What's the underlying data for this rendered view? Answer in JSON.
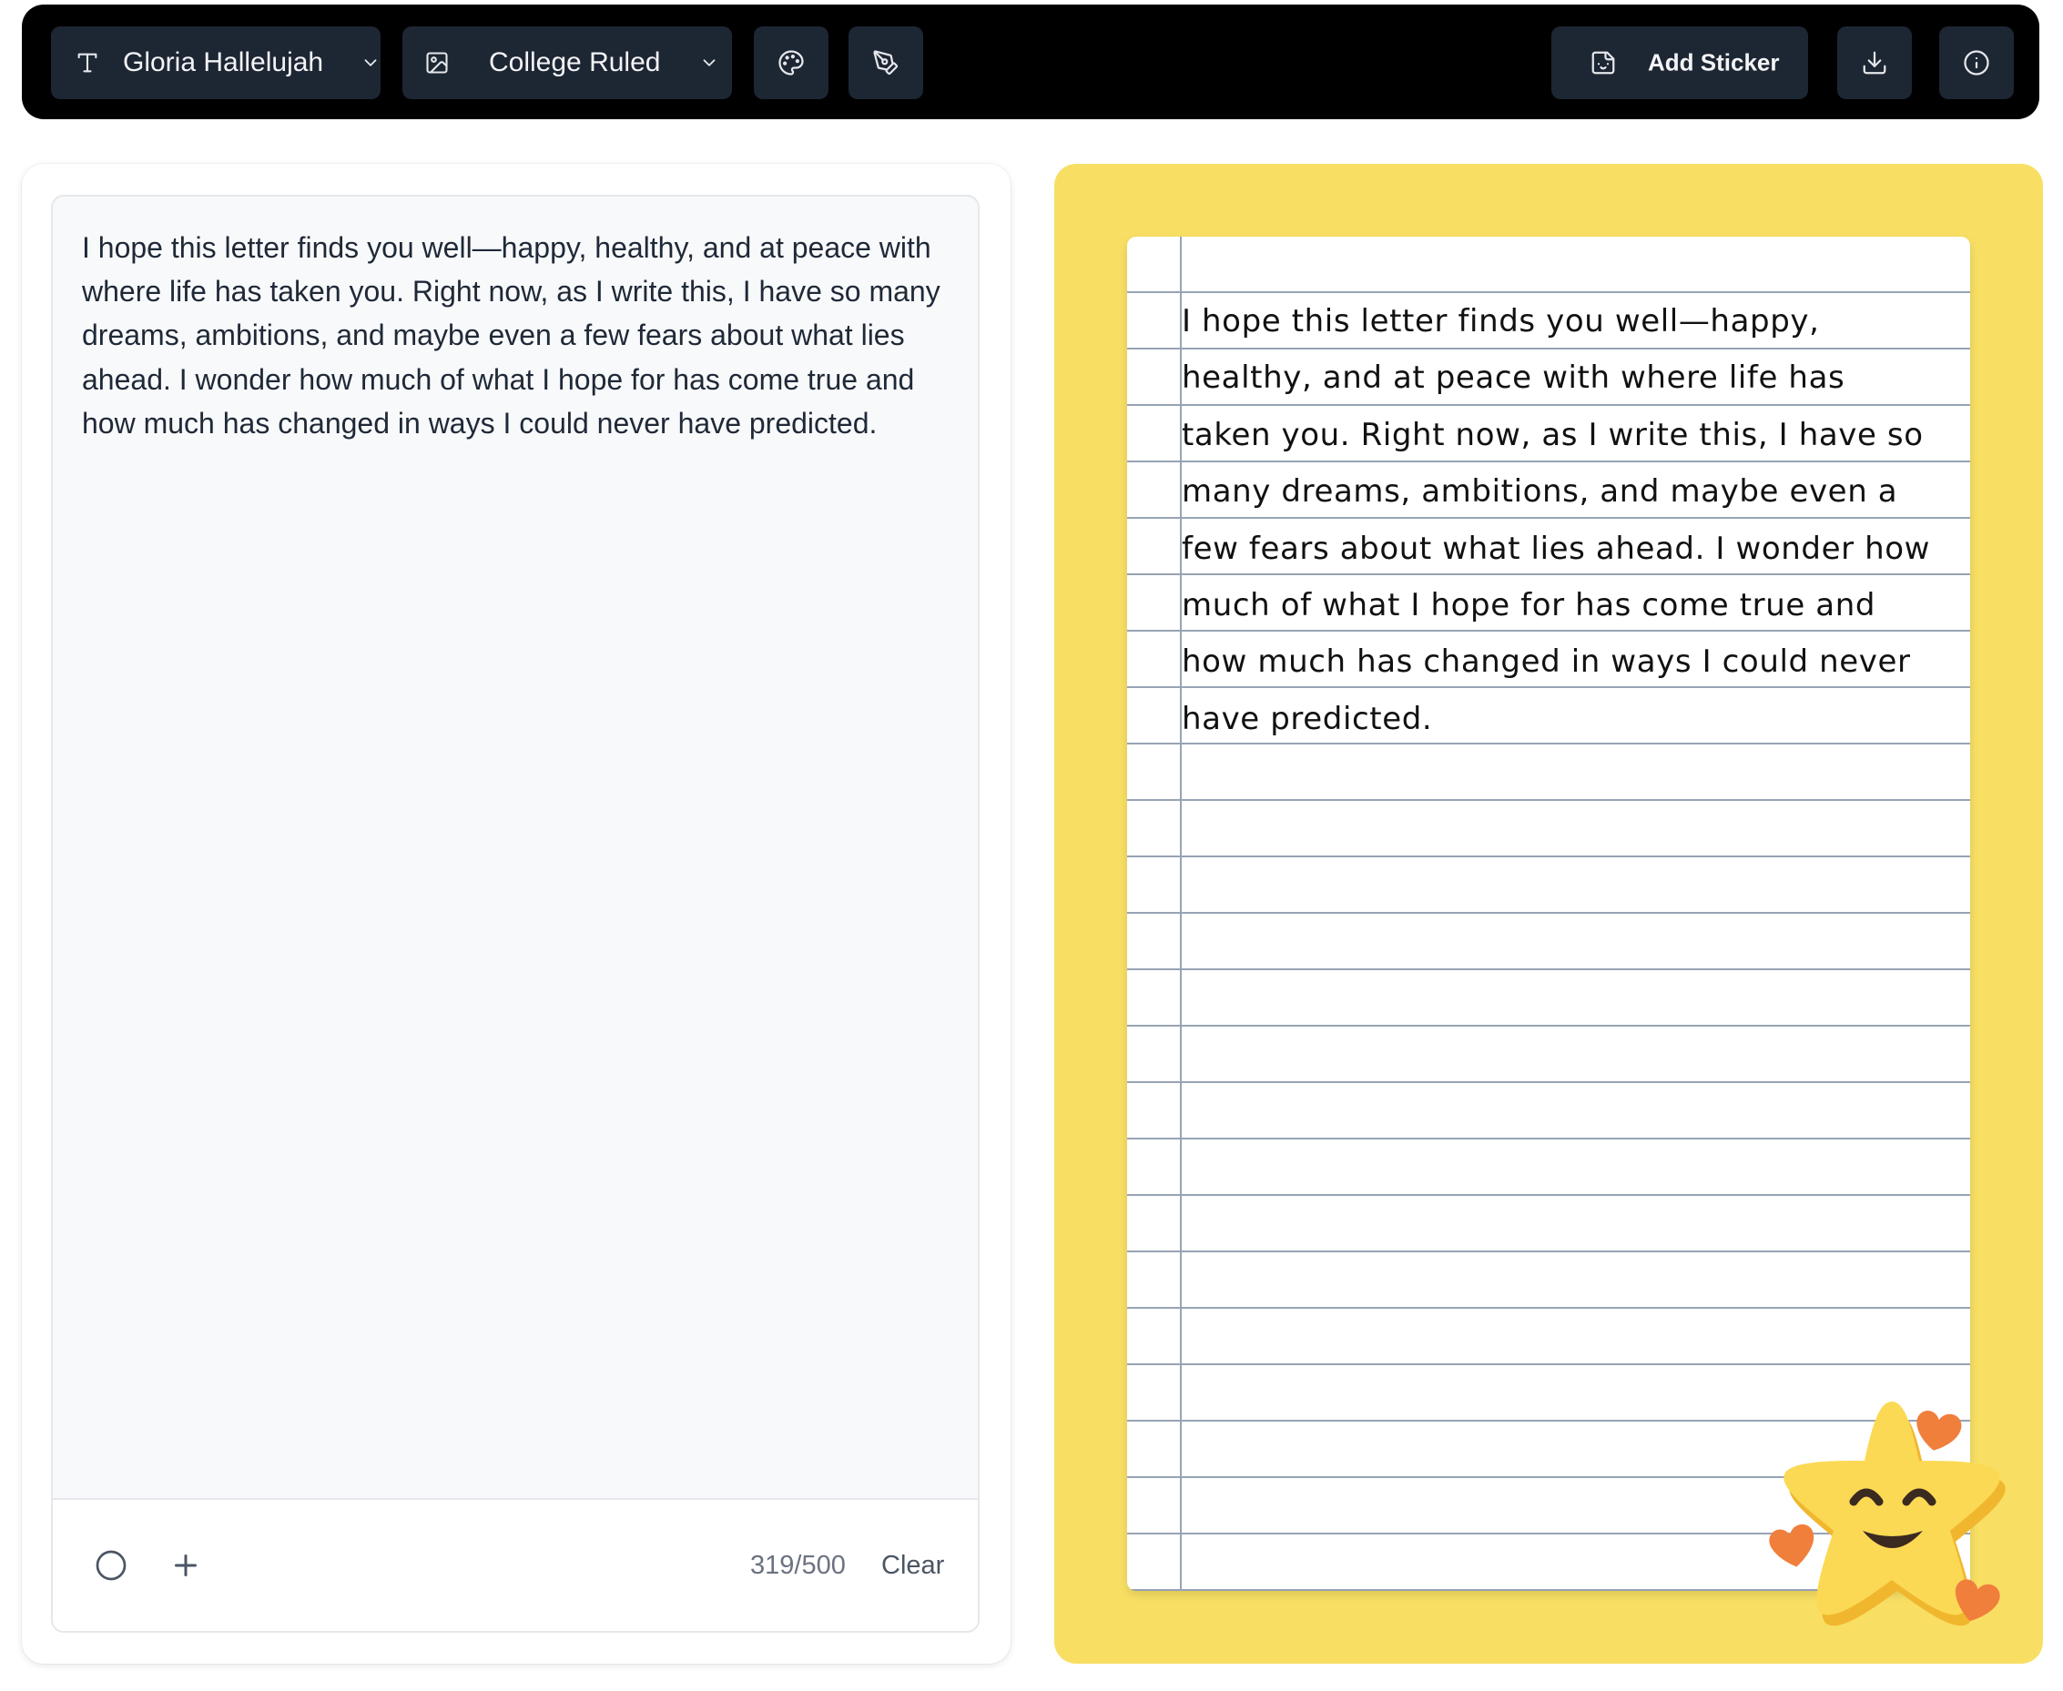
{
  "toolbar": {
    "font_label": "Gloria Hallelujah",
    "paper_label": "College Ruled",
    "add_sticker_label": "Add Sticker"
  },
  "editor": {
    "text": "I hope this letter finds you well—happy, healthy, and at peace with where life has taken you. Right now, as I write this, I have so many dreams, ambitions, and maybe even a few fears about what lies ahead. I wonder how much of what I hope for has come true and how much has changed in ways I could never have predicted.",
    "char_count": "319/500",
    "clear_label": "Clear"
  },
  "preview": {
    "text": "I hope this letter finds you well—happy, healthy, and at peace with where life has taken you. Right now, as I write this, I have so many dreams, ambitions, and maybe even a few fears about what lies ahead. I wonder how much of what I hope for has come true and how much has changed in ways I could never have predicted.",
    "background_color": "#f8df64",
    "sticker": "smiling-star-with-hearts"
  },
  "icons": {
    "font": "type-icon",
    "paper": "image-icon",
    "palette": "palette-icon",
    "pen": "pen-tool-icon",
    "sticker": "sticker-icon",
    "download": "download-icon",
    "info": "info-icon",
    "circle": "circle-icon",
    "plus": "plus-icon"
  }
}
